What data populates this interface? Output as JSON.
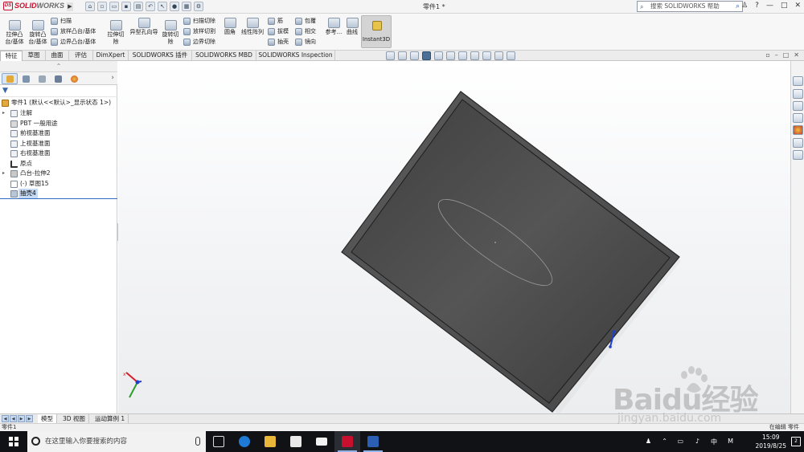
{
  "app": {
    "logo_ds": "DS",
    "logo_solid": "SOLID",
    "logo_works": "WORKS",
    "document_title": "零件1 *",
    "help_search_placeholder": "搜索 SOLIDWORKS 帮助",
    "window_controls": [
      "?",
      "—",
      "□",
      "✕"
    ]
  },
  "ribbon": {
    "extrude_boss": "拉伸凸\n台/基体",
    "revolve_boss": "旋转凸\n台/基体",
    "sweep": "扫描",
    "loft_boss": "放样凸台/基体",
    "boundary_boss": "边界凸台/基体",
    "extrude_cut": "拉伸切\n除",
    "hole_wizard": "异型孔向导",
    "revolve_cut": "旋转切\n除",
    "swept_cut": "扫描切除",
    "lofted_cut": "放样切割",
    "boundary_cut": "边界切除",
    "fillet": "圆角",
    "linear_pattern": "线性阵列",
    "rib": "筋",
    "draft": "拔模",
    "shell": "抽壳",
    "wrap": "包覆",
    "intersect": "相交",
    "mirror": "镜向",
    "reference": "参考...",
    "curves": "曲线",
    "instant3d": "Instant3D"
  },
  "command_tabs": [
    "特征",
    "草图",
    "曲面",
    "评估",
    "DimXpert",
    "SOLIDWORKS 插件",
    "SOLIDWORKS MBD",
    "SOLIDWORKS Inspection"
  ],
  "feature_tree": {
    "root": "零件1 (默认<<默认>_显示状态 1>)",
    "items": [
      {
        "label": "注解",
        "expand": "▸"
      },
      {
        "label": "PBT 一般用途",
        "expand": ""
      },
      {
        "label": "前视基准面",
        "expand": ""
      },
      {
        "label": "上视基准面",
        "expand": ""
      },
      {
        "label": "右视基准面",
        "expand": ""
      },
      {
        "label": "原点",
        "expand": ""
      },
      {
        "label": "凸台-拉伸2",
        "expand": "▸"
      },
      {
        "label": "(-) 草图15",
        "expand": ""
      },
      {
        "label": "抽壳4",
        "expand": ""
      }
    ],
    "more_arrow": "›",
    "collapse_arrows": "⌃"
  },
  "bottom_tabs": [
    "模型",
    "3D 视图",
    "运动算例 1"
  ],
  "status": {
    "left": "零件1",
    "right": "在编辑 零件"
  },
  "taskbar": {
    "search_placeholder": "在这里输入你要搜索的内容",
    "ime": "中",
    "ime_mode": "M",
    "time": "15:09",
    "date": "2019/8/25",
    "notifications": "2"
  },
  "watermark": {
    "main": "Baidu经验",
    "sub": "jingyan.baidu.com"
  },
  "colors": {
    "accent": "#2f6bc2",
    "solidworks_red": "#c8102e",
    "plate_face": "#4a4a4a",
    "taskbar": "#101216"
  }
}
